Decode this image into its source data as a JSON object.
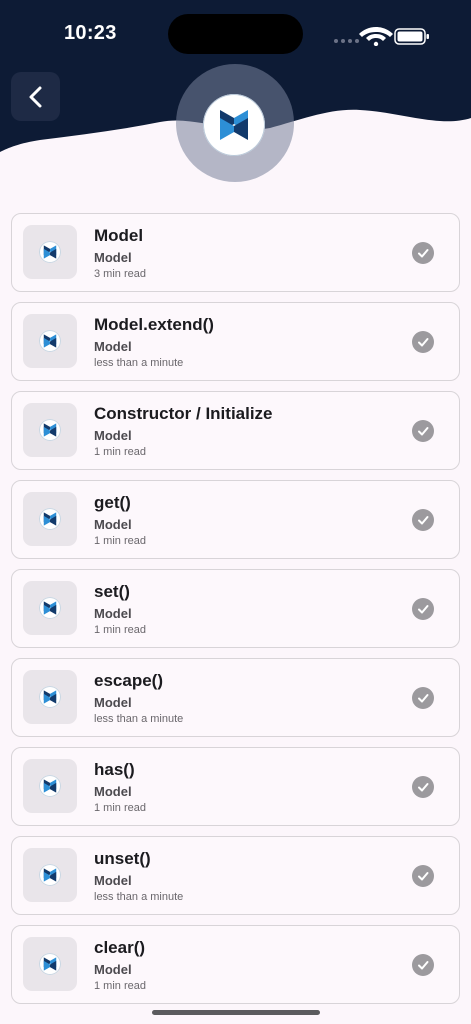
{
  "status_bar": {
    "time": "10:23"
  },
  "colors": {
    "header": "#0d1b35",
    "background": "#fcf6fb",
    "check": "#9c9a9e",
    "logo_dark": "#123a6b",
    "logo_light": "#2d8fd6"
  },
  "header": {
    "back_icon": "chevron-left-icon",
    "logo_icon": "backbone-logo-icon"
  },
  "items": [
    {
      "title": "Model",
      "subtitle": "Model",
      "meta": "3 min read"
    },
    {
      "title": "Model.extend()",
      "subtitle": "Model",
      "meta": "less than a minute"
    },
    {
      "title": "Constructor / Initialize",
      "subtitle": "Model",
      "meta": "1 min read"
    },
    {
      "title": "get()",
      "subtitle": "Model",
      "meta": "1 min read"
    },
    {
      "title": "set()",
      "subtitle": "Model",
      "meta": "1 min read"
    },
    {
      "title": "escape()",
      "subtitle": "Model",
      "meta": "less than a minute"
    },
    {
      "title": "has()",
      "subtitle": "Model",
      "meta": "1 min read"
    },
    {
      "title": "unset()",
      "subtitle": "Model",
      "meta": "less than a minute"
    },
    {
      "title": "clear()",
      "subtitle": "Model",
      "meta": "1 min read"
    }
  ]
}
